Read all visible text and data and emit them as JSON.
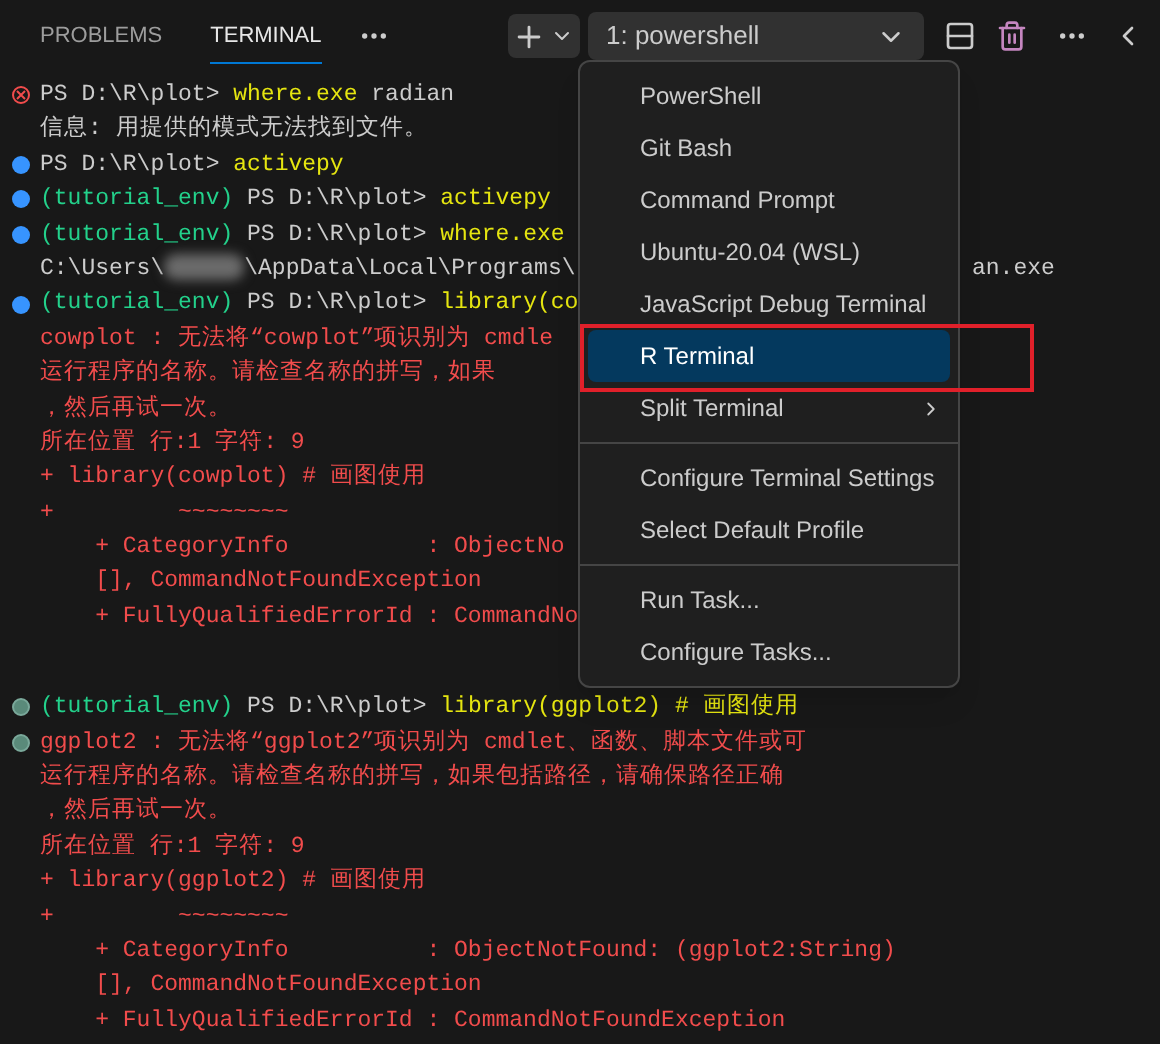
{
  "panel_tabs": [
    {
      "label": "PROBLEMS",
      "selected": false
    },
    {
      "label": "TERMINAL",
      "selected": true
    }
  ],
  "terminal_selector": {
    "value": "1: powershell"
  },
  "terminal_lines": [
    {
      "kind": "error",
      "segments": [
        {
          "kind": "prompt",
          "text": "PS D:\\R\\plot> "
        },
        {
          "kind": "command",
          "text": "where.exe"
        },
        {
          "kind": "output",
          "text": " radian"
        }
      ]
    },
    {
      "kind": "plain",
      "segments": [
        {
          "kind": "output",
          "text": "信息: 用提供的模式无法找到文件。"
        }
      ]
    },
    {
      "kind": "success",
      "segments": [
        {
          "kind": "prompt",
          "text": "PS D:\\R\\plot> "
        },
        {
          "kind": "command",
          "text": "activepy"
        }
      ]
    },
    {
      "kind": "success",
      "segments": [
        {
          "kind": "env",
          "text": "(tutorial_env)"
        },
        {
          "kind": "prompt",
          "text": " PS D:\\R\\plot> "
        },
        {
          "kind": "command",
          "text": "activepy"
        }
      ]
    },
    {
      "kind": "success",
      "segments": [
        {
          "kind": "env",
          "text": "(tutorial_env)"
        },
        {
          "kind": "prompt",
          "text": " PS D:\\R\\plot> "
        },
        {
          "kind": "command",
          "text": "where.exe"
        }
      ]
    },
    {
      "kind": "plain",
      "segments": [
        {
          "kind": "output",
          "text": "C:\\Users\\"
        },
        {
          "kind": "blur"
        },
        {
          "kind": "output",
          "text": "\\AppData\\Local\\Programs\\"
        }
      ],
      "tail": "an.exe"
    },
    {
      "kind": "success",
      "segments": [
        {
          "kind": "env",
          "text": "(tutorial_env)"
        },
        {
          "kind": "prompt",
          "text": " PS D:\\R\\plot> "
        },
        {
          "kind": "command",
          "text": "library(co"
        }
      ]
    },
    {
      "kind": "plain",
      "segments": [
        {
          "kind": "error",
          "text": "cowplot : 无法将“cowplot”项识别为 cmdle"
        }
      ]
    },
    {
      "kind": "plain",
      "segments": [
        {
          "kind": "error",
          "text": "运行程序的名称。请检查名称的拼写，如果"
        }
      ]
    },
    {
      "kind": "plain",
      "segments": [
        {
          "kind": "error",
          "text": "，然后再试一次。"
        }
      ]
    },
    {
      "kind": "plain",
      "segments": [
        {
          "kind": "error",
          "text": "所在位置 行:1 字符: 9"
        }
      ]
    },
    {
      "kind": "plain",
      "segments": [
        {
          "kind": "error",
          "text": "+ library(cowplot) # 画图使用"
        }
      ]
    },
    {
      "kind": "plain",
      "segments": [
        {
          "kind": "error",
          "text": "+         ~~~~~~~~"
        }
      ]
    },
    {
      "kind": "plain",
      "segments": [
        {
          "kind": "error",
          "text": "    + CategoryInfo          : ObjectNo"
        }
      ]
    },
    {
      "kind": "plain",
      "segments": [
        {
          "kind": "error",
          "text": "    [], CommandNotFoundException"
        }
      ]
    },
    {
      "kind": "plain",
      "segments": [
        {
          "kind": "error",
          "text": "    + FullyQualifiedErrorId : CommandNo"
        }
      ]
    },
    {
      "kind": "blank"
    },
    {
      "kind": "neutral",
      "segments": [
        {
          "kind": "env",
          "text": "(tutorial_env)"
        },
        {
          "kind": "prompt",
          "text": " PS D:\\R\\plot> "
        },
        {
          "kind": "command",
          "text": "library(ggplot2) # 画图使用"
        }
      ]
    },
    {
      "kind": "neutral",
      "segments": [
        {
          "kind": "error",
          "text": "ggplot2 : 无法将“ggplot2”项识别为 cmdlet、函数、脚本文件或可"
        }
      ]
    },
    {
      "kind": "plain",
      "segments": [
        {
          "kind": "error",
          "text": "运行程序的名称。请检查名称的拼写，如果包括路径，请确保路径正确"
        }
      ]
    },
    {
      "kind": "plain",
      "segments": [
        {
          "kind": "error",
          "text": "，然后再试一次。"
        }
      ]
    },
    {
      "kind": "plain",
      "segments": [
        {
          "kind": "error",
          "text": "所在位置 行:1 字符: 9"
        }
      ]
    },
    {
      "kind": "plain",
      "segments": [
        {
          "kind": "error",
          "text": "+ library(ggplot2) # 画图使用"
        }
      ]
    },
    {
      "kind": "plain",
      "segments": [
        {
          "kind": "error",
          "text": "+         ~~~~~~~~"
        }
      ]
    },
    {
      "kind": "plain",
      "segments": [
        {
          "kind": "error",
          "text": "    + CategoryInfo          : ObjectNotFound: (ggplot2:String)"
        }
      ]
    },
    {
      "kind": "plain",
      "segments": [
        {
          "kind": "error",
          "text": "    [], CommandNotFoundException"
        }
      ]
    },
    {
      "kind": "plain",
      "segments": [
        {
          "kind": "error",
          "text": "    + FullyQualifiedErrorId : CommandNotFoundException"
        }
      ]
    }
  ],
  "menu": {
    "groups": [
      [
        {
          "label": "PowerShell",
          "selected": false,
          "annotated": false,
          "submenu": false
        },
        {
          "label": "Git Bash",
          "selected": false,
          "annotated": false,
          "submenu": false
        },
        {
          "label": "Command Prompt",
          "selected": false,
          "annotated": false,
          "submenu": false
        },
        {
          "label": "Ubuntu-20.04 (WSL)",
          "selected": false,
          "annotated": false,
          "submenu": false
        },
        {
          "label": "JavaScript Debug Terminal",
          "selected": false,
          "annotated": false,
          "submenu": false
        },
        {
          "label": "R Terminal",
          "selected": true,
          "annotated": true,
          "submenu": false
        },
        {
          "label": "Split Terminal",
          "selected": false,
          "annotated": false,
          "submenu": true
        }
      ],
      [
        {
          "label": "Configure Terminal Settings",
          "selected": false,
          "annotated": false,
          "submenu": false
        },
        {
          "label": "Select Default Profile",
          "selected": false,
          "annotated": false,
          "submenu": false
        }
      ],
      [
        {
          "label": "Run Task...",
          "selected": false,
          "annotated": false,
          "submenu": false
        },
        {
          "label": "Configure Tasks...",
          "selected": false,
          "annotated": false,
          "submenu": false
        }
      ]
    ]
  }
}
